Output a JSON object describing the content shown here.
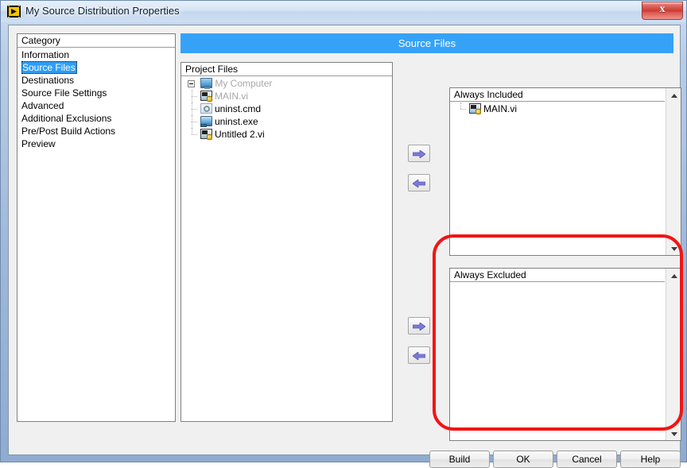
{
  "window": {
    "title": "My Source Distribution Properties",
    "icon": "labview-icon",
    "close_label": "x"
  },
  "banner": {
    "title": "Source Files"
  },
  "category": {
    "header": "Category",
    "items": [
      {
        "label": "Information",
        "selected": false
      },
      {
        "label": "Source Files",
        "selected": true
      },
      {
        "label": "Destinations",
        "selected": false
      },
      {
        "label": "Source File Settings",
        "selected": false
      },
      {
        "label": "Advanced",
        "selected": false
      },
      {
        "label": "Additional Exclusions",
        "selected": false
      },
      {
        "label": "Pre/Post Build Actions",
        "selected": false
      },
      {
        "label": "Preview",
        "selected": false
      }
    ]
  },
  "project_files": {
    "header": "Project Files",
    "tree": [
      {
        "label": "My Computer",
        "icon": "monitor-icon",
        "dimmed": true,
        "level": 0,
        "expanded": true
      },
      {
        "label": "MAIN.vi",
        "icon": "vi-icon",
        "dimmed": true,
        "level": 1
      },
      {
        "label": "uninst.cmd",
        "icon": "gear-icon",
        "dimmed": false,
        "level": 1
      },
      {
        "label": "uninst.exe",
        "icon": "exe-icon",
        "dimmed": false,
        "level": 1
      },
      {
        "label": "Untitled 2.vi",
        "icon": "vi-icon",
        "dimmed": false,
        "level": 1
      }
    ]
  },
  "always_included": {
    "header": "Always Included",
    "items": [
      {
        "label": "MAIN.vi",
        "icon": "vi-icon"
      }
    ]
  },
  "always_excluded": {
    "header": "Always Excluded",
    "items": []
  },
  "transfer_buttons": {
    "included_add": "arrow-right-icon",
    "included_remove": "arrow-left-icon",
    "excluded_add": "arrow-right-icon",
    "excluded_remove": "arrow-left-icon"
  },
  "footer": {
    "build": "Build",
    "ok": "OK",
    "cancel": "Cancel",
    "help": "Help"
  },
  "annotation": {
    "color": "#f41414",
    "target": "always_excluded"
  },
  "colors": {
    "banner": "#36a2f7",
    "selection": "#2e9df5",
    "annotation": "#f41414",
    "arrow": "#6f6fd0"
  }
}
